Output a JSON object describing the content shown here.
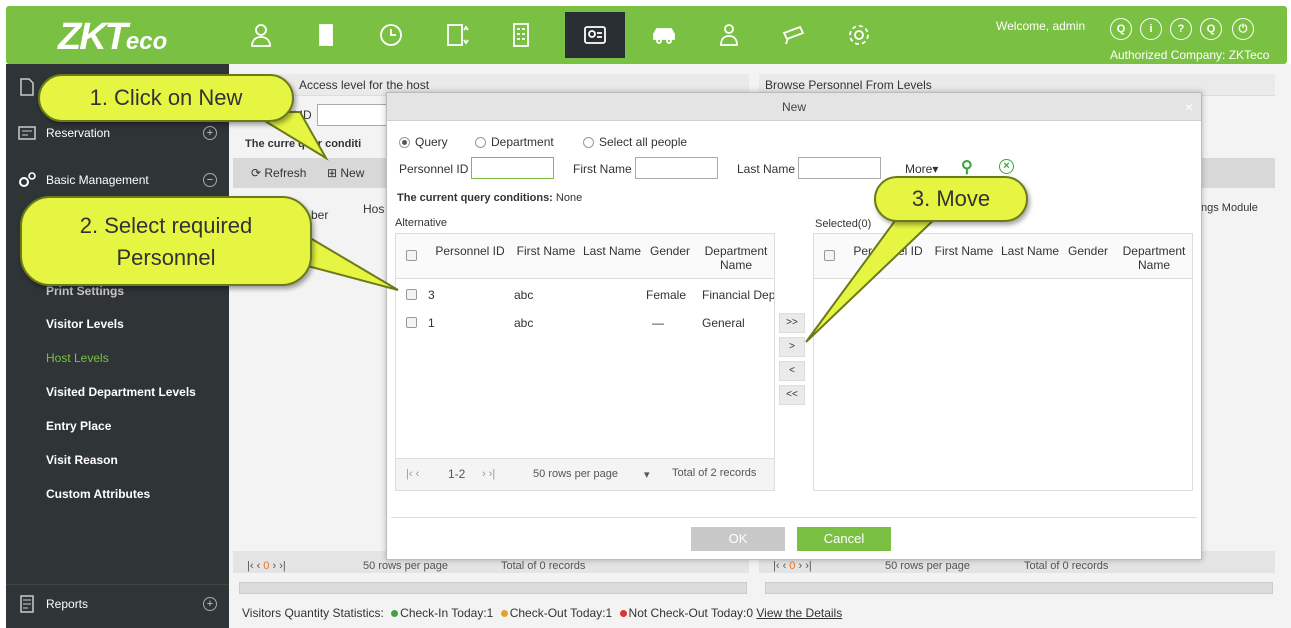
{
  "app": {
    "logo_main": "ZKT",
    "logo_sub": "eco",
    "welcome": "Welcome, admin",
    "authorized": "Authorized Company: ZKTeco",
    "nav_icons": [
      "personnel-icon",
      "door-icon",
      "clock-icon",
      "elevator-icon",
      "building-icon",
      "visitor-icon",
      "car-icon",
      "patrol-icon",
      "camera-icon",
      "settings-icon"
    ],
    "top_icons": [
      "Q",
      "i",
      "?",
      "Q",
      "power"
    ]
  },
  "sidebar": {
    "sections": [
      {
        "label": "",
        "icon": "document-icon"
      },
      {
        "label": "Reservation",
        "icon": "reservation-icon"
      },
      {
        "label": "Basic Management",
        "icon": "gears-icon"
      },
      {
        "label": "Reports",
        "icon": "report-icon"
      }
    ],
    "items": [
      "Print Settings",
      "Visitor Levels",
      "Host Levels",
      "Visited Department Levels",
      "Entry Place",
      "Visit Reason",
      "Custom Attributes"
    ],
    "active_item": "Host Levels"
  },
  "main": {
    "left_header": "Access level for the host",
    "left_field": "el ID",
    "left_query": "The curre quer conditi",
    "refresh": "Refresh",
    "new": "New",
    "col_a": "ber",
    "col_b": "Hos",
    "right_header": "Browse Personnel From Levels",
    "right_col": "ngs Module",
    "pager_left": "0",
    "rows_per_page": "50 rows per page",
    "total_left": "Total of 0 records",
    "total_right": "Total of 0 records",
    "status_label": "Visitors Quantity Statistics:",
    "checkin": "Check-In Today:1",
    "checkout": "Check-Out Today:1",
    "notcheckout": "Not Check-Out Today:0",
    "details_link": "View the Details"
  },
  "dialog": {
    "title": "New",
    "radios": [
      "Query",
      "Department",
      "Select all people"
    ],
    "personnel_id_label": "Personnel ID",
    "first_name_label": "First Name",
    "last_name_label": "Last Name",
    "more": "More",
    "query_conditions_label": "The current query conditions:",
    "query_conditions_value": "None",
    "alternative_label": "Alternative",
    "selected_label": "Selected(0)",
    "columns": [
      "Personnel ID",
      "First Name",
      "Last Name",
      "Gender",
      "Department Name"
    ],
    "rows": [
      {
        "id": "3",
        "first": "abc",
        "last": "",
        "gender": "Female",
        "dept": "Financial Depa"
      },
      {
        "id": "1",
        "first": "abc",
        "last": "",
        "gender": "—",
        "dept": "General"
      }
    ],
    "move_buttons": [
      ">>",
      ">",
      "<",
      "<<"
    ],
    "pager_range": "1-2",
    "rows_per_page": "50 rows per page",
    "total": "Total of 2 records",
    "ok": "OK",
    "cancel": "Cancel"
  },
  "callouts": {
    "c1": "1. Click on New",
    "c2_line1": "2. Select required",
    "c2_line2": "Personnel",
    "c3": "3. Move"
  },
  "colors": {
    "brand_green": "#7ac143",
    "sidebar": "#2f3437",
    "callout": "#e6f542"
  }
}
